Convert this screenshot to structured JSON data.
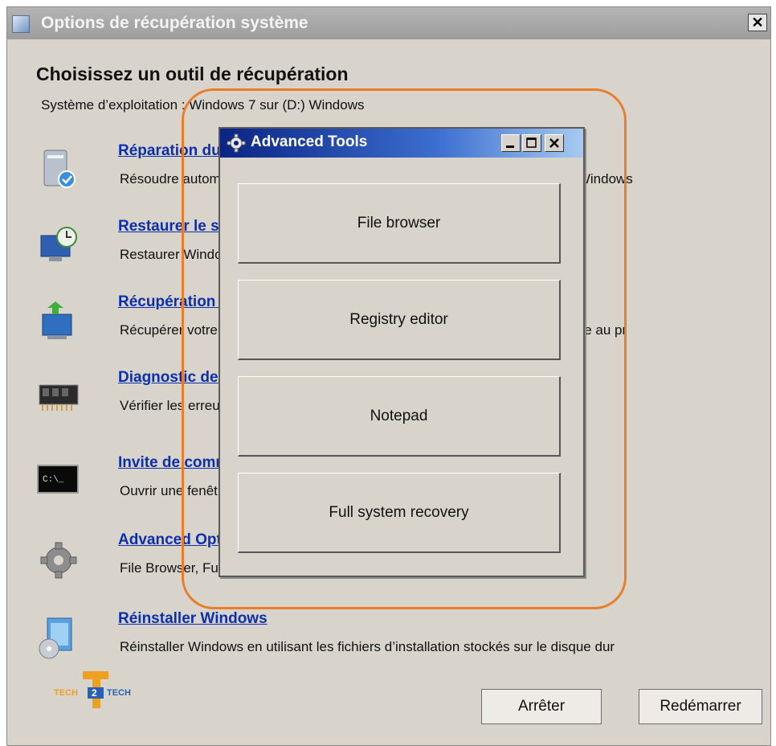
{
  "window": {
    "title": "Options de récupération système",
    "close_label": "✕"
  },
  "heading": "Choisissez un outil de récupération",
  "os_line": "Système d’exploitation : Windows 7 sur (D:) Windows",
  "tools": [
    {
      "link": "Réparation du démarrage",
      "desc": "Résoudre automatiquement les problèmes qui empêchent le démarrage de Windows",
      "icon": "startup-repair-icon"
    },
    {
      "link": "Restaurer le système",
      "desc": "Restaurer Windows à un point antérieur dans le temps",
      "icon": "system-restore-icon"
    },
    {
      "link": "Récupération de l'image système",
      "desc": "Récupérer votre ordinateur à l'aide d'une image système que vous avez créée au pr",
      "icon": "image-recovery-icon"
    },
    {
      "link": "Diagnostic de mémoire Windows",
      "desc": "Vérifier les erreurs de mémoire de l'ordinateur",
      "icon": "memory-chip-icon"
    },
    {
      "link": "Invite de commandes",
      "desc": "Ouvrir une fenêtre d'invite de commandes",
      "icon": "command-prompt-icon"
    },
    {
      "link": "Advanced Options",
      "desc": "File Browser, Full recovery, etc.",
      "icon": "gear-icon"
    },
    {
      "link": "Réinstaller Windows",
      "desc": "Réinstaller Windows en utilisant les fichiers d’installation stockés sur le disque dur",
      "icon": "reinstall-windows-icon"
    }
  ],
  "buttons": {
    "stop": "Arrêter",
    "restart": "Redémarrer"
  },
  "advanced": {
    "title": "Advanced Tools",
    "buttons": [
      "File browser",
      "Registry editor",
      "Notepad",
      "Full system recovery"
    ]
  },
  "logo_text": {
    "left": "TECH",
    "mid": "2",
    "right": "TECH"
  },
  "colors": {
    "highlight": "#e87d2a",
    "link": "#0b2fb0",
    "popup_title": "#0a2484"
  }
}
